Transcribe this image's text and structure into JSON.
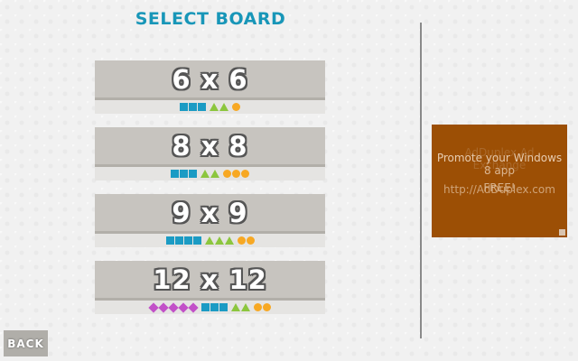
{
  "header": {
    "title": "SELECT BOARD",
    "title_color": "#1896b8"
  },
  "boards": [
    {
      "label": "6 x 6",
      "pieces": {
        "squares": 3,
        "triangles": 2,
        "circles": 1,
        "diamonds": 0
      }
    },
    {
      "label": "8 x 8",
      "pieces": {
        "squares": 3,
        "triangles": 2,
        "circles": 3,
        "diamonds": 0
      }
    },
    {
      "label": "9 x 9",
      "pieces": {
        "squares": 4,
        "triangles": 3,
        "circles": 2,
        "diamonds": 0
      }
    },
    {
      "label": "12 x 12",
      "pieces": {
        "squares": 3,
        "triangles": 2,
        "circles": 2,
        "diamonds": 5
      }
    }
  ],
  "piece_colors": {
    "square": "#1b9bc4",
    "triangle": "#8cc63e",
    "circle": "#f7a823",
    "diamond": "#c251c8"
  },
  "ad": {
    "line1": "Promote your Windows",
    "line1_overlay": "AdDuplex Ad",
    "line2": "8 app",
    "line2_overlay": "Exchange",
    "line3": "http://AdDuplex.com",
    "line3_overlay": "FREE!",
    "background": "#9c4f05"
  },
  "footer": {
    "back_label": "BACK"
  }
}
